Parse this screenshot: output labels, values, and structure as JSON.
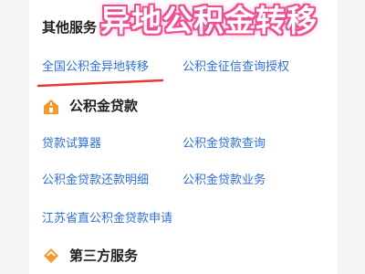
{
  "colors": {
    "link": "#2f6fd6",
    "overlay": "#ef4f92",
    "icon": "#f29a2e",
    "underline": "#e53935"
  },
  "overlay_text": "异地公积金转移",
  "other_services": {
    "title": "其他服务",
    "links": [
      "全国公积金异地转移",
      "公积金征信查询授权"
    ]
  },
  "loan": {
    "title": "公积金贷款",
    "icon": "house-coin-icon",
    "links": [
      "贷款试算器",
      "公积金贷款查询",
      "公积金贷款还款明细",
      "公积金贷款业务",
      "江苏省直公积金贷款申请"
    ]
  },
  "third_party": {
    "title": "第三方服务",
    "icon": "diamond-icon"
  }
}
